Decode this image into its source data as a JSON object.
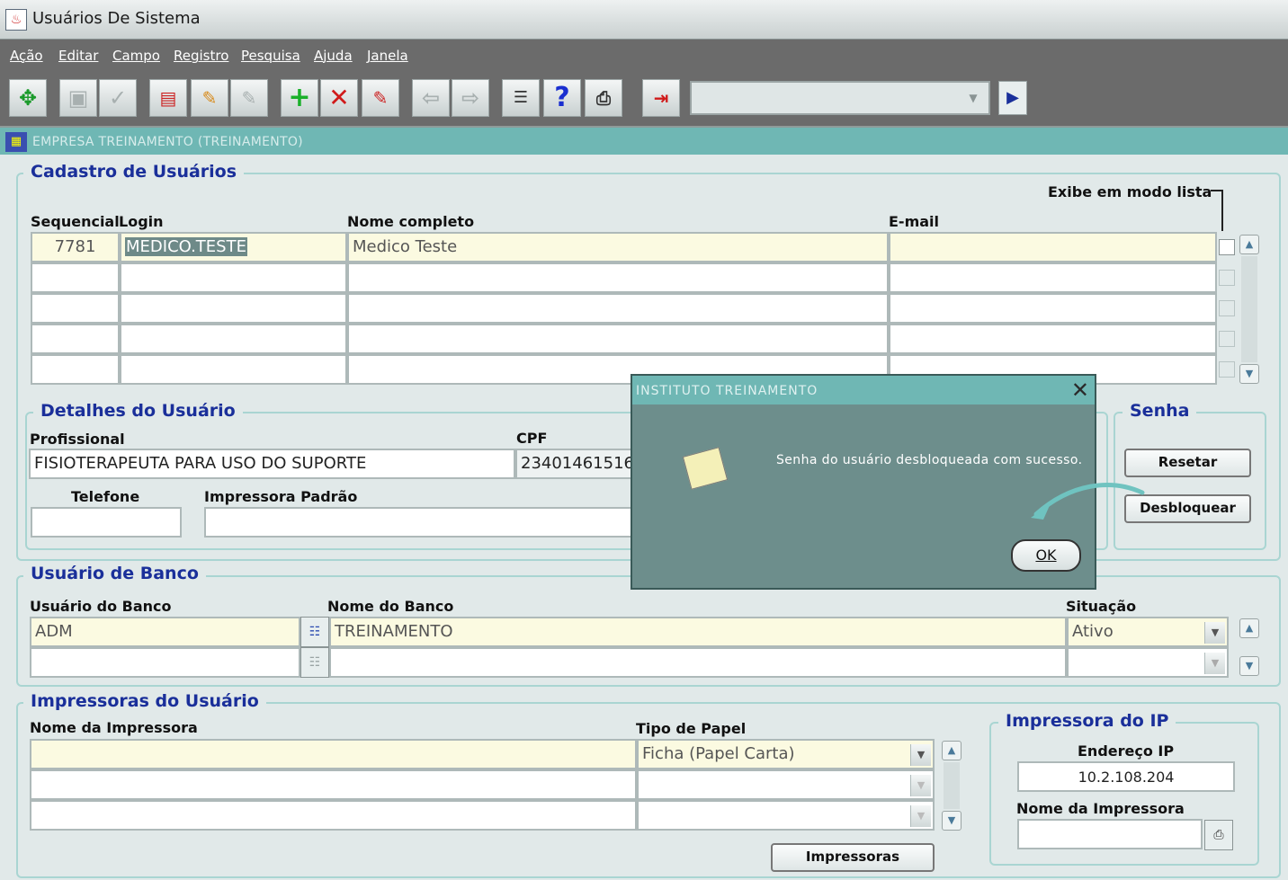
{
  "window": {
    "title": "Usuários De Sistema"
  },
  "menu": [
    "Ação",
    "Editar",
    "Campo",
    "Registro",
    "Pesquisa",
    "Ajuda",
    "Janela"
  ],
  "org_bar": "EMPRESA TREINAMENTO (TREINAMENTO)",
  "cadastro": {
    "title": "Cadastro de Usuários",
    "list_mode_label": "Exibe em modo lista",
    "headers": {
      "seq": "Sequencial",
      "login": "Login",
      "nome": "Nome completo",
      "email": "E-mail"
    },
    "row1": {
      "seq": "7781",
      "login": "MEDICO.TESTE",
      "nome": "Medico Teste",
      "email": ""
    }
  },
  "detalhes": {
    "title": "Detalhes do Usuário",
    "profissional_label": "Profissional",
    "profissional_value": "FISIOTERAPEUTA PARA USO DO SUPORTE",
    "cpf_label": "CPF",
    "cpf_value": "23401461516",
    "telefone_label": "Telefone",
    "impressora_label": "Impressora Padrão"
  },
  "senha": {
    "title": "Senha",
    "reset_label": "Resetar",
    "unlock_label": "Desbloquear"
  },
  "banco": {
    "title": "Usuário de Banco",
    "usuario_label": "Usuário do Banco",
    "nome_label": "Nome do Banco",
    "situacao_label": "Situação",
    "usuario_value": "ADM",
    "nome_value": "TREINAMENTO",
    "situacao_value": "Ativo"
  },
  "impressoras": {
    "title": "Impressoras do Usuário",
    "nome_label": "Nome da Impressora",
    "tipo_label": "Tipo de Papel",
    "tipo_value": "Ficha (Papel Carta)",
    "button_label": "Impressoras"
  },
  "ip": {
    "title": "Impressora do IP",
    "endereco_label": "Endereço IP",
    "endereco_value": "10.2.108.204",
    "nome_label": "Nome da Impressora"
  },
  "dialog": {
    "title": "INSTITUTO TREINAMENTO",
    "message": "Senha do usuário desbloqueada com sucesso.",
    "ok_label": "OK"
  },
  "colors": {
    "accent_teal": "#6fb7b4",
    "title_blue": "#1a2f9a",
    "dialog_bg": "#6d8e8c",
    "highlight": "#fbfae1"
  }
}
